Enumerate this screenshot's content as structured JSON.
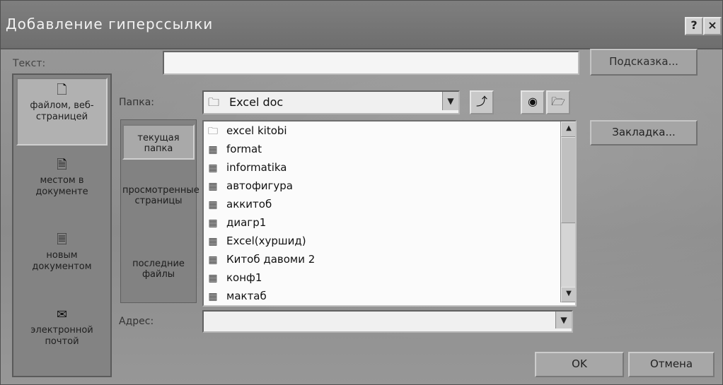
{
  "window": {
    "title": "Добавление гиперссылки",
    "help_icon": "help-icon",
    "close_icon": "close-icon"
  },
  "text_row": {
    "label": "Текст:",
    "value": "",
    "hint_button": "Подсказка..."
  },
  "link_to": [
    {
      "icon": "file-web-icon",
      "label": "файлом, веб-страницей"
    },
    {
      "icon": "document-place-icon",
      "label": "местом в документе"
    },
    {
      "icon": "new-document-icon",
      "label": "новым документом"
    },
    {
      "icon": "email-icon",
      "label": "электронной почтой"
    }
  ],
  "folder": {
    "label": "Папка:",
    "value": "Excel doc"
  },
  "locations": [
    {
      "label": "текущая папка"
    },
    {
      "label": "просмотренные страницы"
    },
    {
      "label": "последние файлы"
    }
  ],
  "files": [
    {
      "icon": "folder-icon",
      "name": "excel kitobi"
    },
    {
      "icon": "excel-file-icon",
      "name": "format"
    },
    {
      "icon": "excel-file-icon",
      "name": "informatika"
    },
    {
      "icon": "excel-file-icon",
      "name": "автофигура"
    },
    {
      "icon": "excel-file-icon",
      "name": "аккитоб"
    },
    {
      "icon": "excel-file-icon",
      "name": "диагр1"
    },
    {
      "icon": "excel-file-icon",
      "name": "Excel(хуршид)"
    },
    {
      "icon": "excel-file-icon",
      "name": "Китоб давоми 2"
    },
    {
      "icon": "excel-file-icon",
      "name": "конф1"
    },
    {
      "icon": "excel-file-icon",
      "name": "мактаб"
    }
  ],
  "bookmark_button": "Закладка...",
  "address": {
    "label": "Адрес:",
    "value": ""
  },
  "buttons": {
    "ok": "OK",
    "cancel": "Отмена"
  }
}
